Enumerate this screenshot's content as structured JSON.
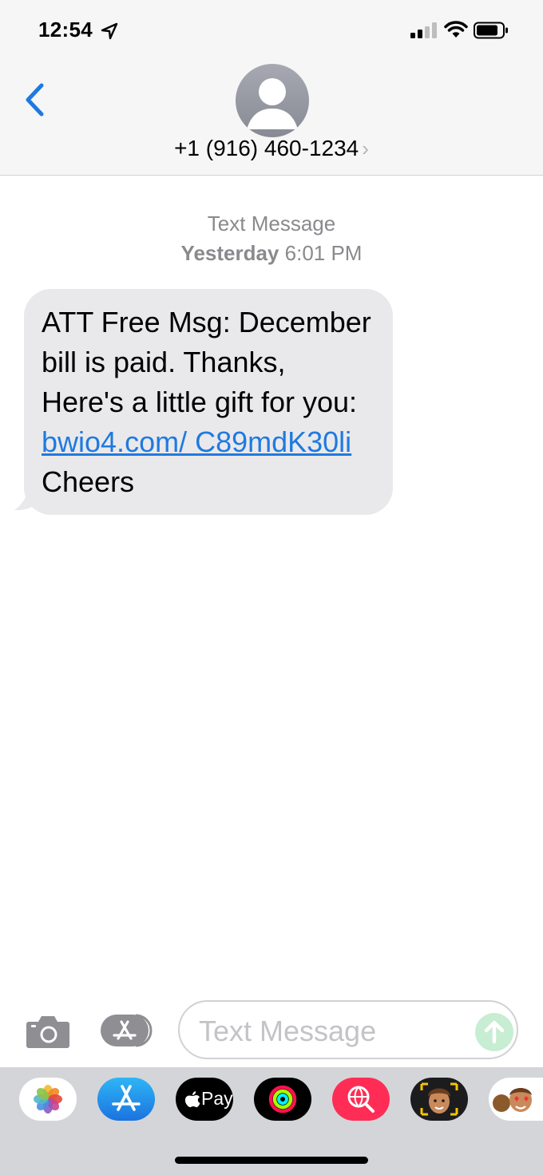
{
  "status_bar": {
    "time": "12:54"
  },
  "header": {
    "contact": "+1 (916) 460-1234",
    "chevron": "›"
  },
  "conversation": {
    "service": "Text Message",
    "day": "Yesterday",
    "time": "6:01 PM",
    "message": {
      "text_before_link": "ATT Free Msg: December bill is paid. Thanks,  Here's a little gift for you: ",
      "link": "bwio4.com/ C89mdK30li",
      "text_after_link": " Cheers"
    }
  },
  "composer": {
    "placeholder": "Text Message"
  },
  "app_strip": {
    "apple_pay_label": "Pay",
    "apps": [
      "photos-app-icon",
      "app-store-icon",
      "apple-pay-icon",
      "activity-icon",
      "image-search-icon",
      "memoji-icon",
      "animoji-stickers-icon"
    ]
  },
  "colors": {
    "link": "#1f7ae0",
    "bubble": "#e9e9eb",
    "header_bg": "#f6f6f6",
    "send_button": "#c7edd2"
  }
}
